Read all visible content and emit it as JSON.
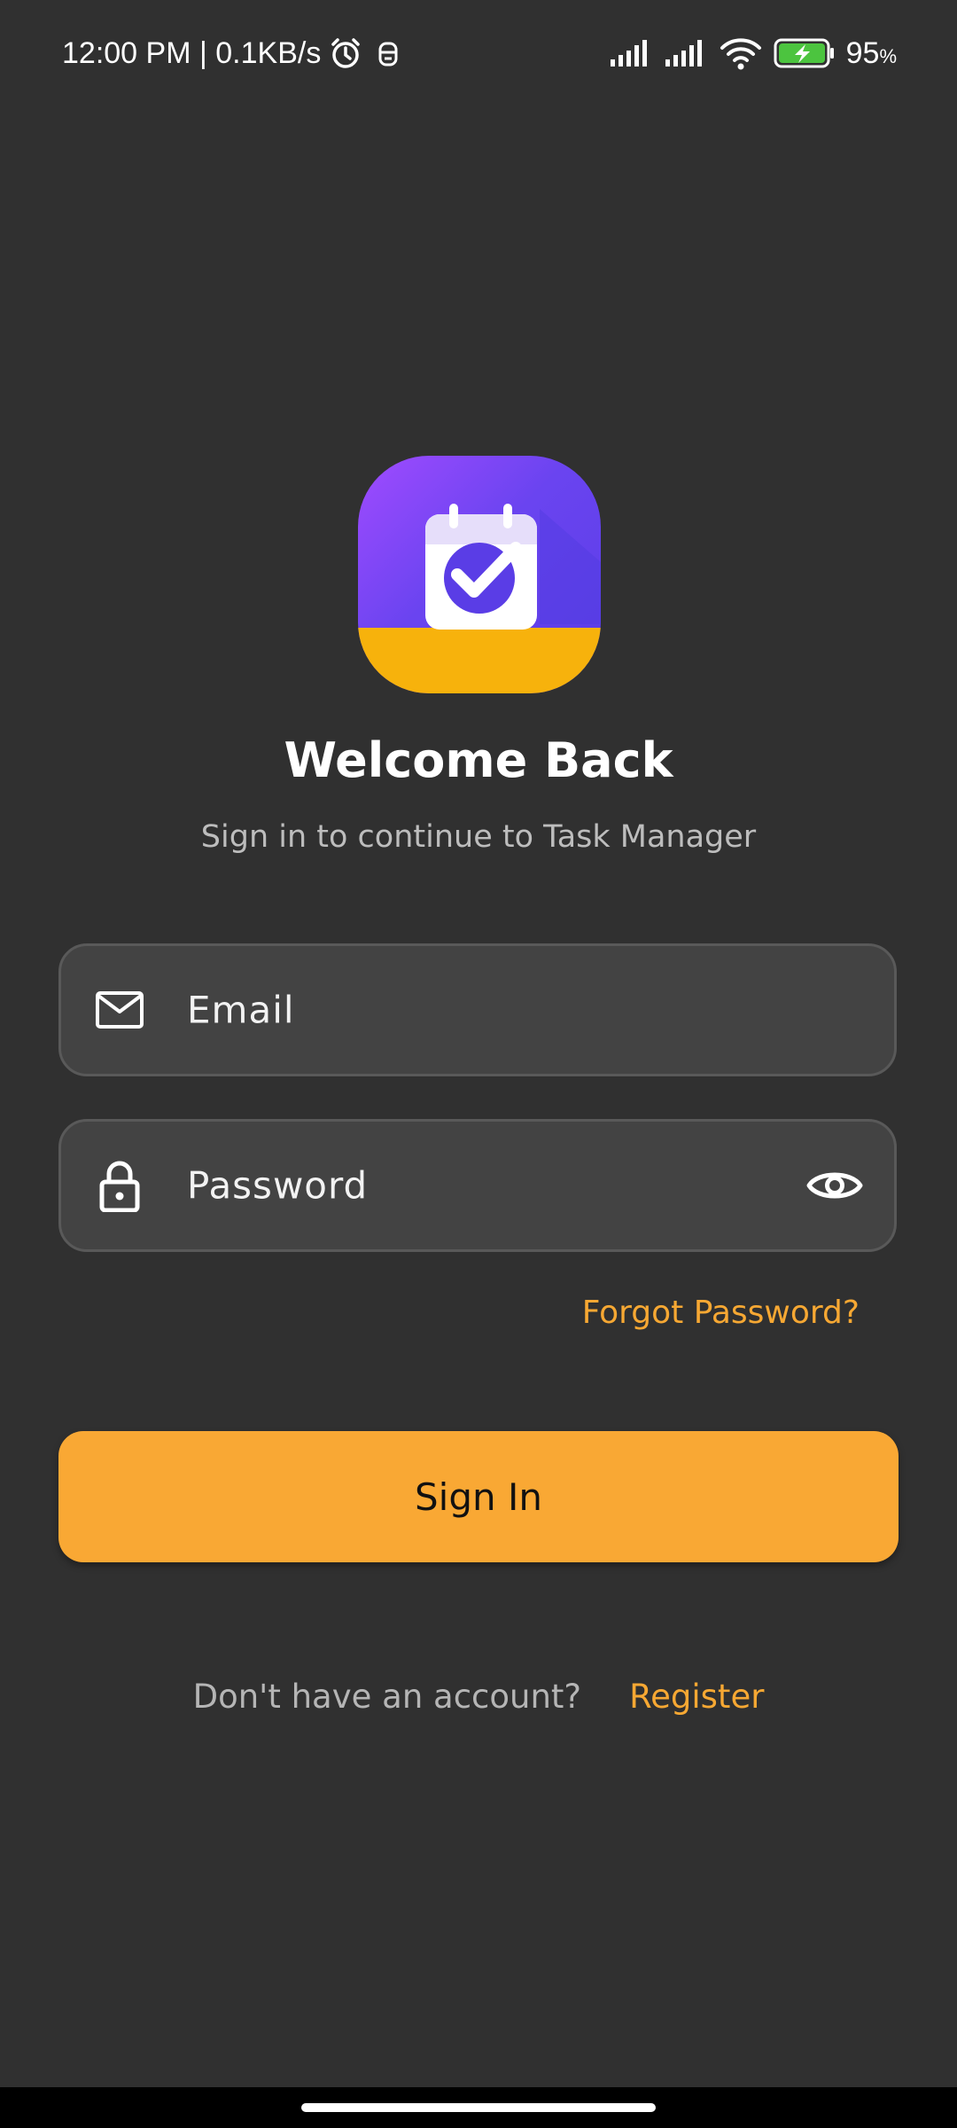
{
  "status_bar": {
    "time_network": "12:00 PM | 0.1KB/s",
    "battery_value": "95",
    "battery_unit": "%",
    "battery_level": 0.95,
    "icons": [
      "alarm-icon",
      "notification-icon",
      "signal-icon",
      "signal-icon",
      "wifi-icon",
      "battery-charging-icon"
    ]
  },
  "logo": {
    "icon": "calendar-check-icon",
    "colors": {
      "gradient_start": "#a04bff",
      "gradient_end": "#5a3de6",
      "band": "#f7b20c"
    }
  },
  "header": {
    "title": "Welcome Back",
    "subtitle": "Sign in to continue to Task Manager"
  },
  "form": {
    "email": {
      "placeholder": "Email",
      "value": "",
      "icon": "mail-icon"
    },
    "password": {
      "placeholder": "Password",
      "value": "",
      "icon": "lock-icon",
      "toggle_icon": "eye-icon"
    },
    "forgot_label": "Forgot Password?",
    "submit_label": "Sign In"
  },
  "footer": {
    "prompt": "Don't have an account?",
    "register_label": "Register"
  },
  "colors": {
    "background": "#303030",
    "field_background": "#434343",
    "accent": "#f9a834",
    "link": "#f7a833"
  }
}
